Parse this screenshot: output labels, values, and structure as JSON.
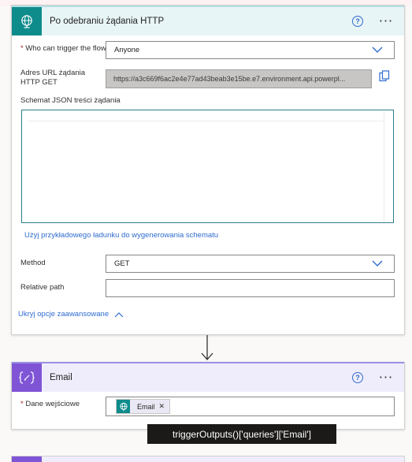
{
  "trigger": {
    "title": "Po odebraniu żądania HTTP",
    "who_label": "Who can trigger the flow?",
    "who_value": "Anyone",
    "url_label": "Adres URL żądania HTTP GET",
    "url_value": "https://a3c669f6ac2e4e77ad43beab3e15be.e7.environment.api.powerpl...",
    "schema_label": "Schemat JSON treści żądania",
    "schema_link": "Użyj przykładowego ładunku do wygenerowania schematu",
    "method_label": "Method",
    "method_value": "GET",
    "relpath_label": "Relative path",
    "relpath_value": "",
    "advanced_link": "Ukryj opcje zaawansowane"
  },
  "email_action": {
    "title": "Email",
    "input_label": "Dane wejściowe",
    "token_label": "Email"
  },
  "tooltip": "triggerOutputs()['queries']['Email']",
  "colors": {
    "teal": "#0e8b8b",
    "purple": "#7f55d6",
    "link": "#2f6ccf"
  }
}
